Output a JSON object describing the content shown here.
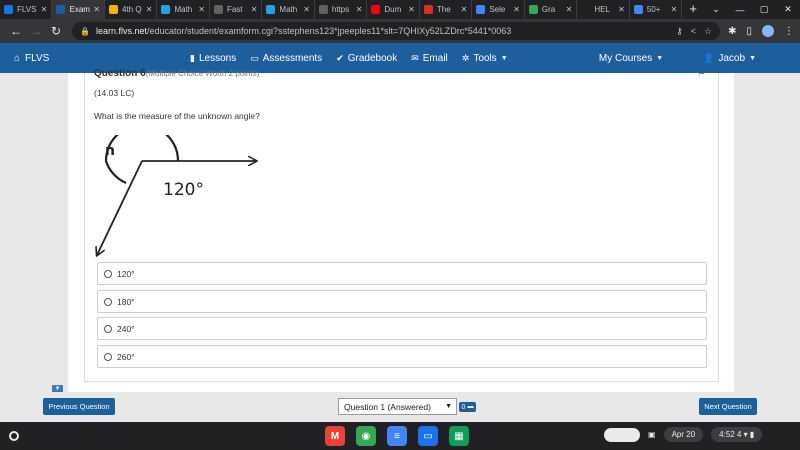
{
  "browser": {
    "tabs": [
      {
        "label": "FLVS",
        "color": "#1a73e8",
        "icon": "globe-icon",
        "active": false
      },
      {
        "label": "Exam",
        "color": "#1d5e9c",
        "icon": "flvs-icon",
        "active": true
      },
      {
        "label": "4th Q",
        "color": "#f4b400",
        "icon": "slides-icon",
        "active": false
      },
      {
        "label": "Math",
        "color": "#26a3dd",
        "icon": "math-icon",
        "active": false
      },
      {
        "label": "Fast",
        "color": "#5f6368",
        "icon": "globe-icon",
        "active": false
      },
      {
        "label": "Math",
        "color": "#26a3dd",
        "icon": "math-icon",
        "active": false
      },
      {
        "label": "https",
        "color": "#5f6368",
        "icon": "globe-icon",
        "active": false
      },
      {
        "label": "Dum",
        "color": "#ff0000",
        "icon": "youtube-icon",
        "active": false
      },
      {
        "label": "The",
        "color": "#d93025",
        "icon": "x-icon",
        "active": false
      },
      {
        "label": "Sele",
        "color": "#4285f4",
        "icon": "google-icon",
        "active": false
      },
      {
        "label": "Gra",
        "color": "#34a853",
        "icon": "globe-icon",
        "active": false
      },
      {
        "label": "HEL",
        "color": "#202124",
        "icon": "hash-icon",
        "active": false
      },
      {
        "label": "50+",
        "color": "#4285f4",
        "icon": "google-icon",
        "active": false
      }
    ],
    "new_tab": "+",
    "url_host": "learn.flvs.net",
    "url_path": "/educator/student/examform.cgi?sstephens123*jpeeples11*slt=7QHIXy52LZDrc*5441*0063"
  },
  "sitenav": {
    "brand": "FLVS",
    "lessons": "Lessons",
    "assessments": "Assessments",
    "gradebook": "Gradebook",
    "email": "Email",
    "tools": "Tools",
    "my_courses": "My Courses",
    "user": "Jacob"
  },
  "question": {
    "title": "Question 6",
    "points": "(Multiple Choice Worth 2 points)",
    "code": "(14.03 LC)",
    "prompt": "What is the measure of the unknown angle?",
    "figure": {
      "unknown_label": "n",
      "known_label": "120°"
    },
    "choices": [
      "120°",
      "180°",
      "240°",
      "260°"
    ]
  },
  "footer": {
    "prev": "Previous Question",
    "select_value": "Question 1 (Answered)",
    "badge": "0",
    "next": "Next Question"
  },
  "shelf": {
    "date": "Apr 20",
    "time": "4:52",
    "notifications": "4",
    "apps": [
      {
        "name": "gmail-app",
        "color": "#ea4335",
        "glyph": "M"
      },
      {
        "name": "chrome-app",
        "color": "#34a853",
        "glyph": "◉"
      },
      {
        "name": "docs-app",
        "color": "#4285f4",
        "glyph": "≡"
      },
      {
        "name": "files-app",
        "color": "#1a73e8",
        "glyph": "▭"
      },
      {
        "name": "sheets-app",
        "color": "#0f9d58",
        "glyph": "▦"
      }
    ]
  }
}
